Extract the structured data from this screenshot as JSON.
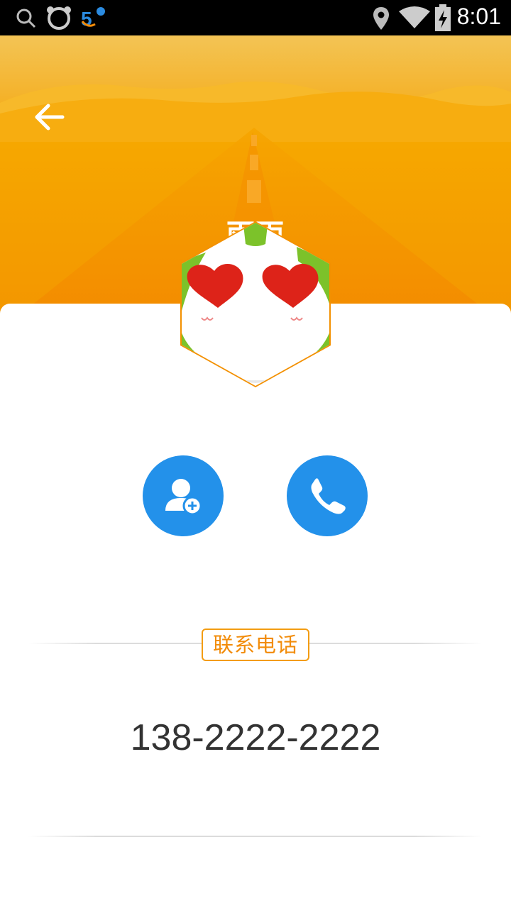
{
  "status_bar": {
    "time": "8:01",
    "icons_left": [
      "search-icon",
      "bear-app-icon",
      "app-4g-icon"
    ],
    "icons_right": [
      "location-icon",
      "wifi-icon",
      "battery-charging-icon"
    ]
  },
  "header": {
    "back_icon": "arrow-left-icon",
    "contact_name": "雨雨",
    "colors": {
      "top": "#f2c04e",
      "middle": "#f6a800",
      "bottom": "#f39800"
    }
  },
  "actions": {
    "add_contact_icon": "add-person-icon",
    "call_icon": "phone-icon",
    "color": "#2391ea"
  },
  "contact_info": {
    "section_label": "联系电话",
    "phone_number": "138-2222-2222",
    "accent_color": "#f39c12"
  }
}
